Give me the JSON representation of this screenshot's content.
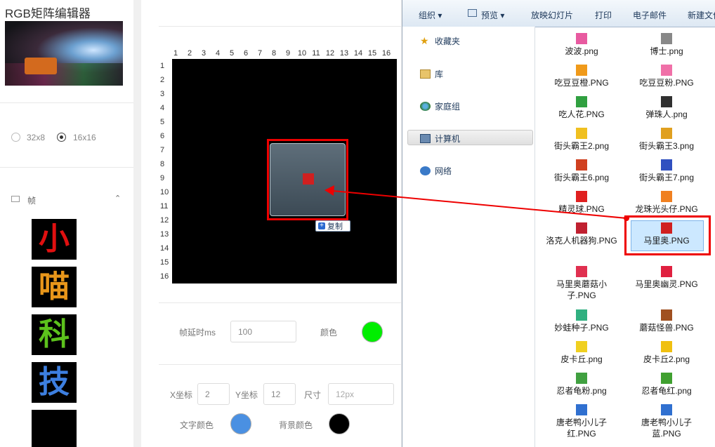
{
  "app": {
    "title": "RGB矩阵编辑器"
  },
  "size_options": [
    {
      "label": "32x8",
      "selected": false
    },
    {
      "label": "16x16",
      "selected": true
    }
  ],
  "frames_section": {
    "label": "帧",
    "icon": "mail-icon",
    "toggle_icon": "chevron-up-icon"
  },
  "frames": [
    {
      "char": "小",
      "color": "#e01010"
    },
    {
      "char": "喵",
      "color": "#e8961a"
    },
    {
      "char": "科",
      "color": "#5cc21c"
    },
    {
      "char": "技",
      "color": "#3d7fe0"
    },
    {
      "char": "",
      "color": "#000000"
    }
  ],
  "matrix": {
    "cols": [
      "1",
      "2",
      "3",
      "4",
      "5",
      "6",
      "7",
      "8",
      "9",
      "10",
      "11",
      "12",
      "13",
      "14",
      "15",
      "16"
    ],
    "rows": [
      "1",
      "2",
      "3",
      "4",
      "5",
      "6",
      "7",
      "8",
      "9",
      "10",
      "11",
      "12",
      "13",
      "14",
      "15",
      "16"
    ]
  },
  "drag": {
    "copy_label": "复制",
    "copy_icon": "plus-icon"
  },
  "settings": {
    "delay_label": "帧延时ms",
    "delay_value": "100",
    "color_label": "颜色",
    "color": "#00ee00",
    "x_label": "X坐标",
    "x_value": "2",
    "y_label": "Y坐标",
    "y_value": "12",
    "size_label": "尺寸",
    "size_placeholder": "12px",
    "text_color_label": "文字颜色",
    "text_color": "#4a90e2",
    "bg_color_label": "背景颜色",
    "bg_color": "#000000"
  },
  "explorer": {
    "toolbar": [
      {
        "label": "组织 ▾",
        "icon": ""
      },
      {
        "label": "预览 ▾",
        "icon": "preview-icon"
      },
      {
        "label": "放映幻灯片",
        "icon": ""
      },
      {
        "label": "打印",
        "icon": ""
      },
      {
        "label": "电子邮件",
        "icon": ""
      },
      {
        "label": "新建文件",
        "icon": ""
      }
    ],
    "nav": [
      {
        "label": "收藏夹",
        "icon": "star-icon"
      },
      {
        "label": "库",
        "icon": "library-icon"
      },
      {
        "label": "家庭组",
        "icon": "homegroup-icon"
      },
      {
        "label": "计算机",
        "icon": "computer-icon",
        "selected": true
      },
      {
        "label": "网络",
        "icon": "network-icon"
      }
    ],
    "files": [
      {
        "name": "波波.png",
        "color": "#e85aa0"
      },
      {
        "name": "博士.png",
        "color": "#888888"
      },
      {
        "name": "吃豆豆橙.PNG",
        "color": "#f09a1a"
      },
      {
        "name": "吃豆豆粉.PNG",
        "color": "#f070a8"
      },
      {
        "name": "吃人花.PNG",
        "color": "#30a040"
      },
      {
        "name": "弹珠人.png",
        "color": "#303030"
      },
      {
        "name": "街头霸王2.png",
        "color": "#f0c020"
      },
      {
        "name": "街头霸王3.png",
        "color": "#e0a020"
      },
      {
        "name": "街头霸王6.png",
        "color": "#d04020"
      },
      {
        "name": "街头霸王7.png",
        "color": "#3050c0"
      },
      {
        "name": "精灵球.PNG",
        "color": "#e02020"
      },
      {
        "name": "龙珠光头仔.PNG",
        "color": "#f08020"
      },
      {
        "name": "洛克人机器狗.PNG",
        "color": "#c02030"
      },
      {
        "name": "马里奥.PNG",
        "color": "#d02020",
        "selected": true
      },
      {
        "name": "马里奥蘑菇小子.PNG",
        "color": "#e03050"
      },
      {
        "name": "马里奥幽灵.PNG",
        "color": "#e02040"
      },
      {
        "name": "妙蛙种子.PNG",
        "color": "#30b080"
      },
      {
        "name": "蘑菇怪兽.PNG",
        "color": "#a05020"
      },
      {
        "name": "皮卡丘.png",
        "color": "#f0d020"
      },
      {
        "name": "皮卡丘2.png",
        "color": "#f0c010"
      },
      {
        "name": "忍者龟粉.png",
        "color": "#40a040"
      },
      {
        "name": "忍者龟红.png",
        "color": "#40a030"
      },
      {
        "name": "唐老鸭小儿子红.PNG",
        "color": "#3070d0"
      },
      {
        "name": "唐老鸭小儿子蓝.PNG",
        "color": "#3070d0"
      }
    ]
  }
}
